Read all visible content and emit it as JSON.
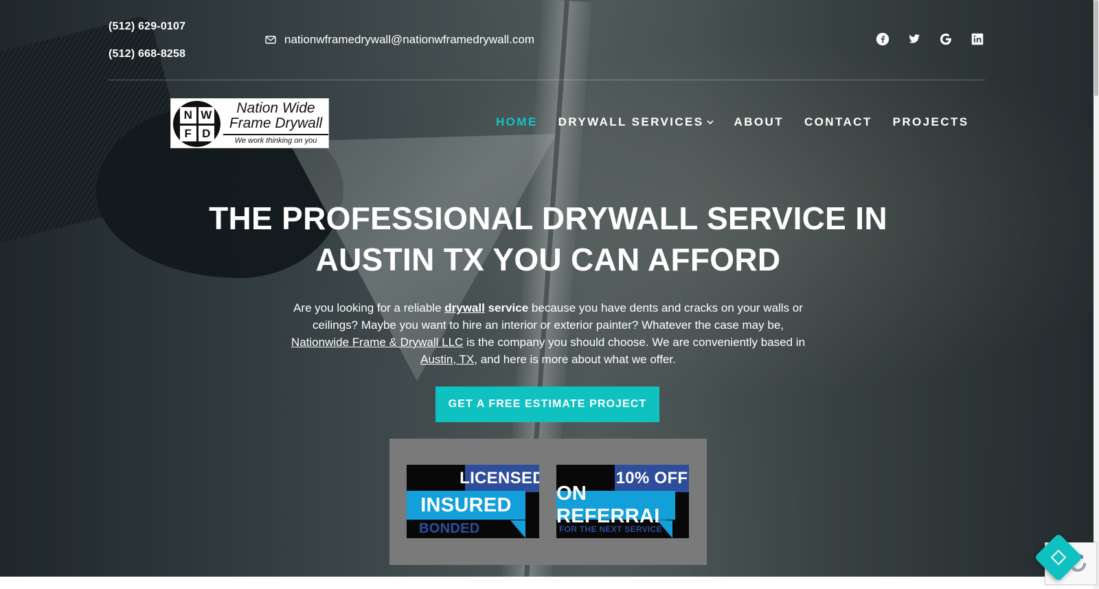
{
  "topbar": {
    "phones": [
      "(512) 629-0107",
      "(512) 668-8258"
    ],
    "email": "nationwframedrywall@nationwframedrywall.com",
    "social_icons": [
      "facebook-icon",
      "twitter-icon",
      "google-icon",
      "linkedin-icon"
    ]
  },
  "logo": {
    "letters": [
      "N",
      "W",
      "F",
      "D"
    ],
    "name": "Nation Wide\nFrame Drywall",
    "tagline": "We work thinking on you"
  },
  "nav": {
    "items": [
      {
        "label": "HOME",
        "active": true
      },
      {
        "label": "DRYWALL SERVICES",
        "dropdown": true
      },
      {
        "label": "ABOUT"
      },
      {
        "label": "CONTACT"
      },
      {
        "label": "PROJECTS"
      }
    ]
  },
  "hero": {
    "title_line_1": "THE PROFESSIONAL DRYWALL SERVICE IN",
    "title_line_2": "AUSTIN TX YOU CAN AFFORD",
    "copy": {
      "part_1": "Are you looking for a reliable ",
      "drywall_link": "drywall",
      "part_2": " ",
      "service_bold": "service",
      "part_3": " because you have dents and cracks on your walls or ceilings? Maybe you want to hire an interior or exterior painter? Whatever the case may be,",
      "company_link": " Nationwide Frame & Drywall LLC",
      "part_4": " is the company you should choose. We are conveniently based in ",
      "location_link": "Austin, TX",
      "part_5": ", and here is more about what we offer."
    },
    "cta_label": "GET A FREE ESTIMATE PROJECT"
  },
  "badges": [
    {
      "top": "LICENSED",
      "middle": "INSURED",
      "bottom": "BONDED"
    },
    {
      "top": "10% OFF",
      "middle": "ON REFERRAL",
      "bottom": "FOR THE NEXT SERVICE"
    }
  ],
  "colors": {
    "accent": "#10c1c2",
    "badge_blue": "#129fda",
    "badge_navy": "#2e4d9b",
    "panel_gray": "#7a7a7a"
  },
  "widgets": {
    "floating_button_icon": "diamond-icon",
    "captcha_icon": "recaptcha-icon"
  }
}
